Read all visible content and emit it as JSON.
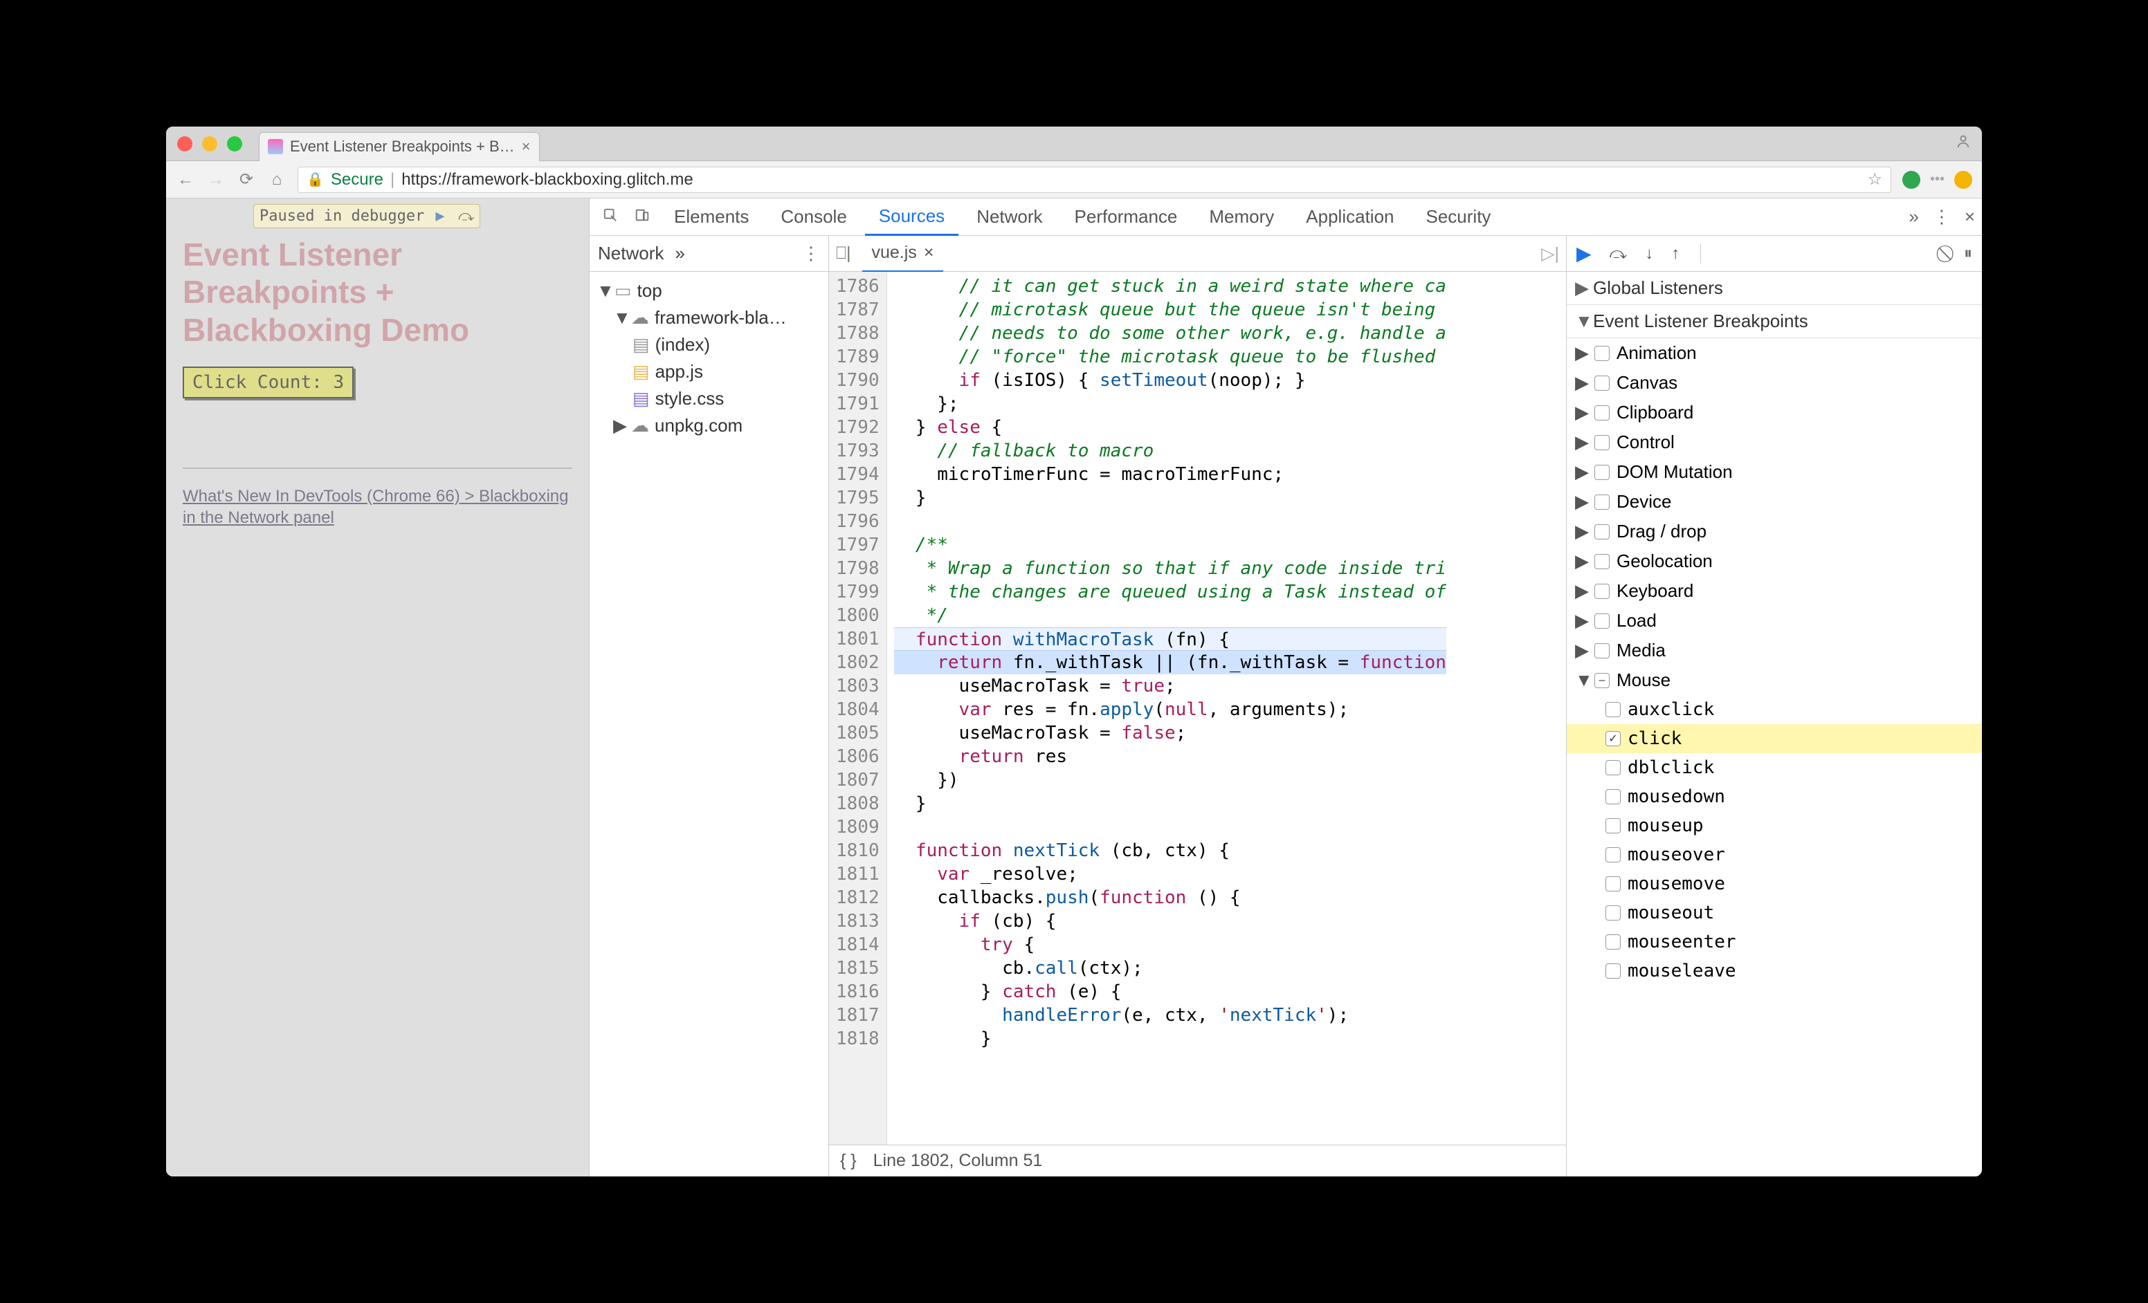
{
  "browser": {
    "tab_title": "Event Listener Breakpoints + B…",
    "secure_label": "Secure",
    "url_display": "https://framework-blackboxing.glitch.me"
  },
  "page": {
    "paused_text": "Paused in debugger",
    "heading": "Event Listener Breakpoints + Blackboxing Demo",
    "button_label": "Click Count: 3",
    "link_text": "What's New In DevTools (Chrome 66) > Blackboxing in the Network panel"
  },
  "devtools": {
    "tabs": [
      "Elements",
      "Console",
      "Sources",
      "Network",
      "Performance",
      "Memory",
      "Application",
      "Security"
    ],
    "active_tab": "Sources",
    "navigator_tab": "Network",
    "file_tree": {
      "top": "top",
      "domain": "framework-bla…",
      "files": [
        "(index)",
        "app.js",
        "style.css"
      ],
      "external": "unpkg.com"
    },
    "open_file": "vue.js",
    "status": "Line 1802, Column 51",
    "gutter_start": 1786,
    "gutter_end": 1818,
    "highlight_line": 1802,
    "code_lines": [
      "      // it can get stuck in a weird state where ca",
      "      // microtask queue but the queue isn't being ",
      "      // needs to do some other work, e.g. handle a",
      "      // \"force\" the microtask queue to be flushed",
      "      if (isIOS) { setTimeout(noop); }",
      "    };",
      "  } else {",
      "    // fallback to macro",
      "    microTimerFunc = macroTimerFunc;",
      "  }",
      "",
      "  /**",
      "   * Wrap a function so that if any code inside tri",
      "   * the changes are queued using a Task instead of",
      "   */",
      "  function withMacroTask (fn) {",
      "    return fn._withTask || (fn._withTask = function",
      "      useMacroTask = true;",
      "      var res = fn.apply(null, arguments);",
      "      useMacroTask = false;",
      "      return res",
      "    })",
      "  }",
      "",
      "  function nextTick (cb, ctx) {",
      "    var _resolve;",
      "    callbacks.push(function () {",
      "      if (cb) {",
      "        try {",
      "          cb.call(ctx);",
      "        } catch (e) {",
      "          handleError(e, ctx, 'nextTick');",
      "        }"
    ],
    "right_pane": {
      "sections": [
        "Global Listeners",
        "Event Listener Breakpoints"
      ],
      "categories": [
        "Animation",
        "Canvas",
        "Clipboard",
        "Control",
        "DOM Mutation",
        "Device",
        "Drag / drop",
        "Geolocation",
        "Keyboard",
        "Load",
        "Media"
      ],
      "expanded": "Mouse",
      "mouse_events": [
        "auxclick",
        "click",
        "dblclick",
        "mousedown",
        "mouseup",
        "mouseover",
        "mousemove",
        "mouseout",
        "mouseenter",
        "mouseleave"
      ],
      "checked_event": "click"
    }
  }
}
